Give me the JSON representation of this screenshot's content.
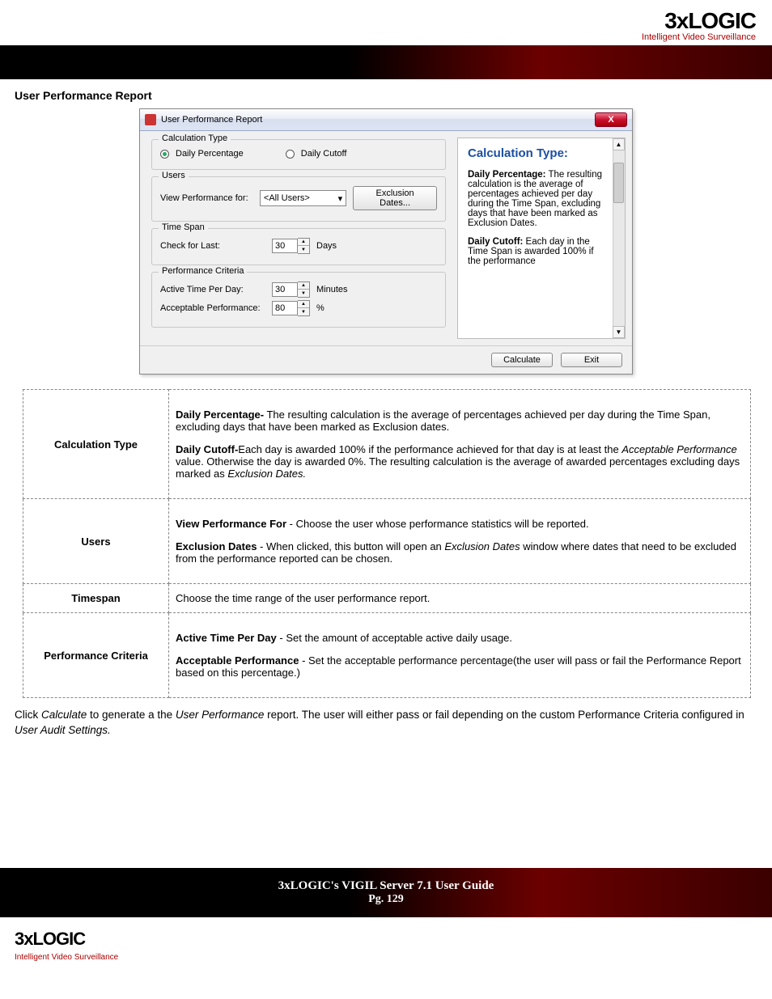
{
  "brand": {
    "name": "3xLOGIC",
    "tag": "Intelligent Video Surveillance"
  },
  "section_heading": "User Performance Report",
  "dialog": {
    "title": "User Performance Report",
    "close_x": "X",
    "groups": {
      "calc": {
        "legend": "Calculation Type",
        "opt_daily_percentage": "Daily Percentage",
        "opt_daily_cutoff": "Daily Cutoff"
      },
      "users": {
        "legend": "Users",
        "view_label": "View Performance for:",
        "select_value": "<All Users>",
        "exclusion_btn": "Exclusion Dates..."
      },
      "timespan": {
        "legend": "Time Span",
        "check_label": "Check for Last:",
        "value": "30",
        "unit": "Days"
      },
      "criteria": {
        "legend": "Performance Criteria",
        "active_label": "Active Time Per Day:",
        "active_value": "30",
        "active_unit": "Minutes",
        "acceptable_label": "Acceptable Performance:",
        "acceptable_value": "80",
        "acceptable_unit": "%"
      }
    },
    "help": {
      "title": "Calculation Type:",
      "dp_label": "Daily Percentage:",
      "dp_text": " The resulting calculation is the average of percentages achieved per day during the Time Span, excluding days that have been marked as Exclusion Dates.",
      "dc_label": "Daily Cutoff:",
      "dc_text": " Each day in the Time Span is awarded 100% if the performance"
    },
    "footer": {
      "calculate": "Calculate",
      "exit": "Exit"
    }
  },
  "table": {
    "calc_key": "Calculation Type",
    "calc_html_dp_b": "Daily Percentage-",
    "calc_html_dp_t": " The resulting calculation is the average of percentages achieved per day during the Time Span, excluding days that have been marked as Exclusion dates.",
    "calc_html_dc_b": "Daily Cutoff-",
    "calc_html_dc_t1": "Each day is awarded 100% if the performance achieved for that day is at least the ",
    "calc_html_dc_em1": "Acceptable Performance",
    "calc_html_dc_t2": " value. Otherwise the day is awarded 0%. The resulting calculation is the average of awarded percentages excluding days marked as ",
    "calc_html_dc_em2": "Exclusion Dates.",
    "users_key": "Users",
    "users_vpf_b": "View Performance For",
    "users_vpf_t": " - Choose the user whose performance statistics will be reported.",
    "users_ed_b": "Exclusion Dates",
    "users_ed_t1": " - When clicked, this button will open an ",
    "users_ed_em": "Exclusion Dates",
    "users_ed_t2": " window where dates that need to be excluded from the performance reported can be chosen.",
    "timespan_key": "Timespan",
    "timespan_text": "Choose the time range of the user performance report.",
    "criteria_key": "Performance Criteria",
    "criteria_atpd_b": "Active Time Per Day",
    "criteria_atpd_t": " - Set the amount of acceptable active daily usage.",
    "criteria_ap_b": "Acceptable Performance",
    "criteria_ap_t": " - Set the acceptable performance percentage(the user will pass or fail the Performance Report based on this percentage.)"
  },
  "body_para": {
    "t1": "Click ",
    "em1": "Calculate",
    "t2": " to generate a the ",
    "em2": "User Performance",
    "t3": " report. The user will either pass or fail depending on the custom Performance Criteria configured in ",
    "em3": "User Audit Settings."
  },
  "footer": {
    "title": "3xLOGIC's VIGIL Server 7.1 User Guide",
    "pg": "Pg. 129"
  }
}
